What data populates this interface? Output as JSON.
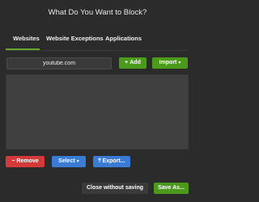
{
  "dialog": {
    "title": "What Do You Want to Block?"
  },
  "tabs": [
    {
      "label": "Websites",
      "active": true
    },
    {
      "label": "Website Exceptions",
      "active": false
    },
    {
      "label": "Applications",
      "active": false
    }
  ],
  "site_entry": {
    "value": "youtube.com"
  },
  "buttons": {
    "add": "Add",
    "import": "Import",
    "remove": "Remove",
    "select": "Select",
    "export": "Export...",
    "close": "Close without saving",
    "save": "Save As..."
  },
  "icons": {
    "add": "plus-icon",
    "import": "chevron-down-icon",
    "remove": "minus-icon",
    "select": "chevron-down-icon",
    "export": "upload-icon"
  },
  "colors": {
    "background": "#2b2b2b",
    "green": "#4c9a1c",
    "red": "#d43a3a",
    "blue": "#3a7bd5",
    "tab_underline": "#6aa832"
  }
}
